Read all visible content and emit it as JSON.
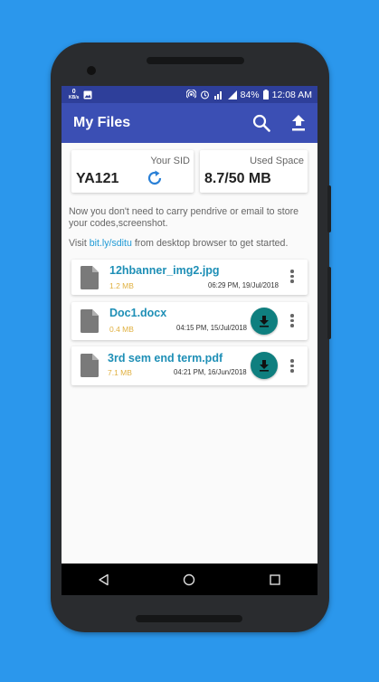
{
  "status_bar": {
    "speed_value": "0",
    "speed_unit": "KB/s",
    "battery": "84%",
    "time": "12:08 AM"
  },
  "app_bar": {
    "title": "My Files",
    "search_icon": "search-icon",
    "upload_icon": "upload-icon"
  },
  "sid_card": {
    "label": "Your SID",
    "value": "YA121",
    "refresh_icon": "refresh-icon"
  },
  "space_card": {
    "label": "Used Space",
    "value": "8.7/50 MB"
  },
  "info": {
    "line1": "Now you don't need to carry pendrive or email to store your codes,screenshot.",
    "visit_prefix": "Visit ",
    "link": "bit.ly/sditu",
    "visit_suffix": " from desktop browser to get started."
  },
  "files": [
    {
      "name": "12hbanner_img2.jpg",
      "size": "1.2 MB",
      "date": "06:29 PM, 19/Jul/2018",
      "downloadable": false
    },
    {
      "name": "Doc1.docx",
      "size": "0.4 MB",
      "date": "04:15 PM, 15/Jul/2018",
      "downloadable": true
    },
    {
      "name": "3rd sem end term.pdf",
      "size": "7.1 MB",
      "date": "04:21 PM, 16/Jun/2018",
      "downloadable": true
    }
  ],
  "colors": {
    "background": "#2b97ec",
    "app_bar": "#3b4fb4",
    "status_bar": "#2e3f9a",
    "file_name": "#1e8fb6",
    "file_size": "#e0b040",
    "download_button": "#0f7f7f"
  }
}
